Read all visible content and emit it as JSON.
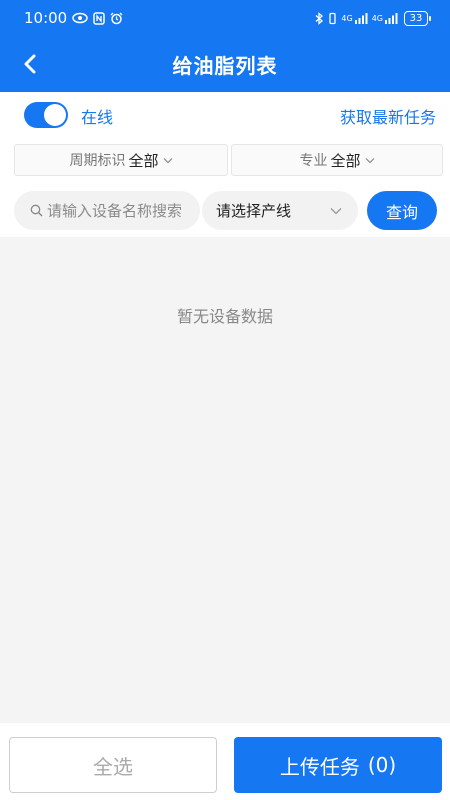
{
  "status_bar": {
    "time": "10:00",
    "network_label_1": "4G",
    "network_label_2": "4G",
    "battery": "33",
    "icons": [
      "eye-icon",
      "nfc-icon",
      "alarm-icon",
      "bluetooth-icon",
      "vibrate-icon",
      "signal-icon",
      "signal-icon",
      "battery-icon"
    ]
  },
  "header": {
    "title": "给油脂列表",
    "back_icon": "chevron-left-icon"
  },
  "online": {
    "label": "在线",
    "toggle_on": true,
    "fetch_tasks": "获取最新任务"
  },
  "filters": {
    "cycle": {
      "label": "周期标识",
      "value": "全部"
    },
    "major": {
      "label": "专业",
      "value": "全部"
    }
  },
  "search": {
    "placeholder": "请输入设备名称搜索",
    "value": ""
  },
  "line_select": {
    "placeholder": "请选择产线"
  },
  "query_button": "查询",
  "empty_message": "暂无设备数据",
  "bottom": {
    "select_all": "全选",
    "upload_label": "上传任务",
    "upload_count": "(0)"
  },
  "colors": {
    "primary": "#1677f2",
    "background": "#f4f4f4"
  }
}
